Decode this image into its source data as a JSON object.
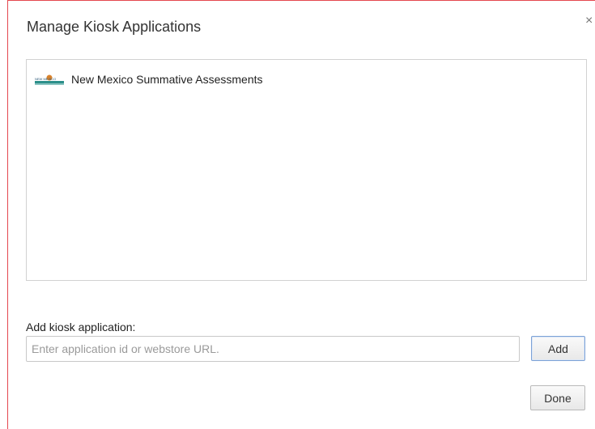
{
  "dialog": {
    "title": "Manage Kiosk Applications",
    "close_glyph": "×"
  },
  "app_list": {
    "items": [
      {
        "name": "New Mexico Summative Assessments",
        "icon": "new-mexico-logo-icon",
        "logo_text": "NEW MEXICO"
      }
    ]
  },
  "add_section": {
    "label": "Add kiosk application:",
    "input_value": "",
    "input_placeholder": "Enter application id or webstore URL.",
    "add_button": "Add"
  },
  "footer": {
    "done_button": "Done"
  },
  "colors": {
    "dialog_border": "#e4474f",
    "add_button_border": "#7da2d6",
    "logo_teal": "#2c8f8a",
    "logo_orange": "#d9822b"
  }
}
